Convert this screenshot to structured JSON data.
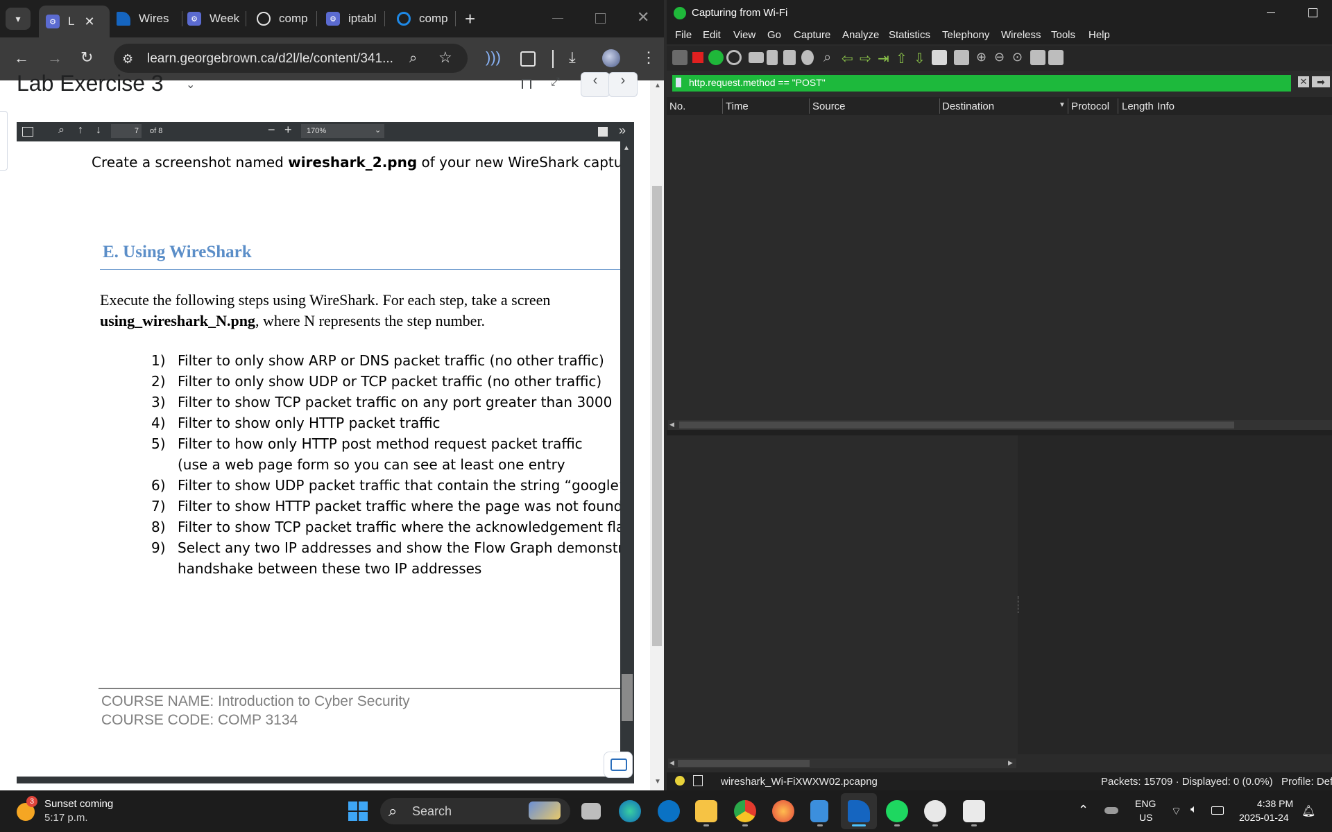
{
  "chrome": {
    "tabs": [
      {
        "label": "L",
        "active": true
      },
      {
        "label": "Wires"
      },
      {
        "label": "Week"
      },
      {
        "label": "comp"
      },
      {
        "label": "iptabl"
      },
      {
        "label": "comp"
      }
    ],
    "new_tab": "+",
    "url": "learn.georgebrown.ca/d2l/le/content/341...",
    "page_title": "Lab Exercise 3",
    "pdf": {
      "page_number": "7",
      "page_count": "of 8",
      "zoom": "170%"
    }
  },
  "doc": {
    "intro": {
      "pre": "Create a screenshot named ",
      "bold": "wireshark_2.png",
      "post": " of your new WireShark capture"
    },
    "heading": "E. Using WireShark",
    "para1": "Execute the following steps using WireShark. For each step, take a screen",
    "para2_bold": "using_wireshark_N.png",
    "para2_rest": ", where N represents the step number.",
    "steps": [
      {
        "n": "1)",
        "text": "Filter to only show ARP or DNS packet traffic (no other traffic)"
      },
      {
        "n": "2)",
        "text": "Filter to only show UDP or TCP packet traffic (no other traffic)"
      },
      {
        "n": "3)",
        "text": "Filter to show TCP packet traffic on any port greater than 3000"
      },
      {
        "n": "4)",
        "text": "Filter to show only HTTP packet traffic"
      },
      {
        "n": "5)",
        "text": "Filter to how only HTTP post method request packet traffic"
      },
      {
        "n": "",
        "text": "(use a web page form so you can see at least one entry"
      },
      {
        "n": "6)",
        "text": "Filter to show UDP packet traffic that contain the string “google”"
      },
      {
        "n": "7)",
        "text": "Filter to show HTTP packet traffic where the page was not found"
      },
      {
        "n": "8)",
        "text": "Filter to show TCP packet traffic where the acknowledgement fla"
      },
      {
        "n": "9)",
        "text": "Select any two IP addresses and show the Flow Graph demonstr"
      },
      {
        "n": "",
        "text": "handshake between these two IP addresses"
      }
    ],
    "footer_line1": "COURSE NAME: Introduction to Cyber Security",
    "footer_line2": "COURSE CODE: COMP 3134"
  },
  "wireshark": {
    "title": "Capturing from Wi-Fi",
    "menu": [
      "File",
      "Edit",
      "View",
      "Go",
      "Capture",
      "Analyze",
      "Statistics",
      "Telephony",
      "Wireless",
      "Tools",
      "Help"
    ],
    "filter": "http.request.method == \"POST\"",
    "columns": [
      "No.",
      "Time",
      "Source",
      "Destination",
      "Protocol",
      "Length",
      "Info"
    ],
    "status_file": "wireshark_Wi-FiXWXW02.pcapng",
    "status_packets": "Packets: 15709 · Displayed: 0 (0.0%)",
    "status_profile": "Profile: Def",
    "filter_color": "#1db93c"
  },
  "taskbar": {
    "weather_badge": "3",
    "weather_title": "Sunset coming",
    "weather_time": "5:17 p.m.",
    "search": "Search",
    "lang1": "ENG",
    "lang2": "US",
    "clock_time": "4:38 PM",
    "clock_date": "2025-01-24"
  }
}
